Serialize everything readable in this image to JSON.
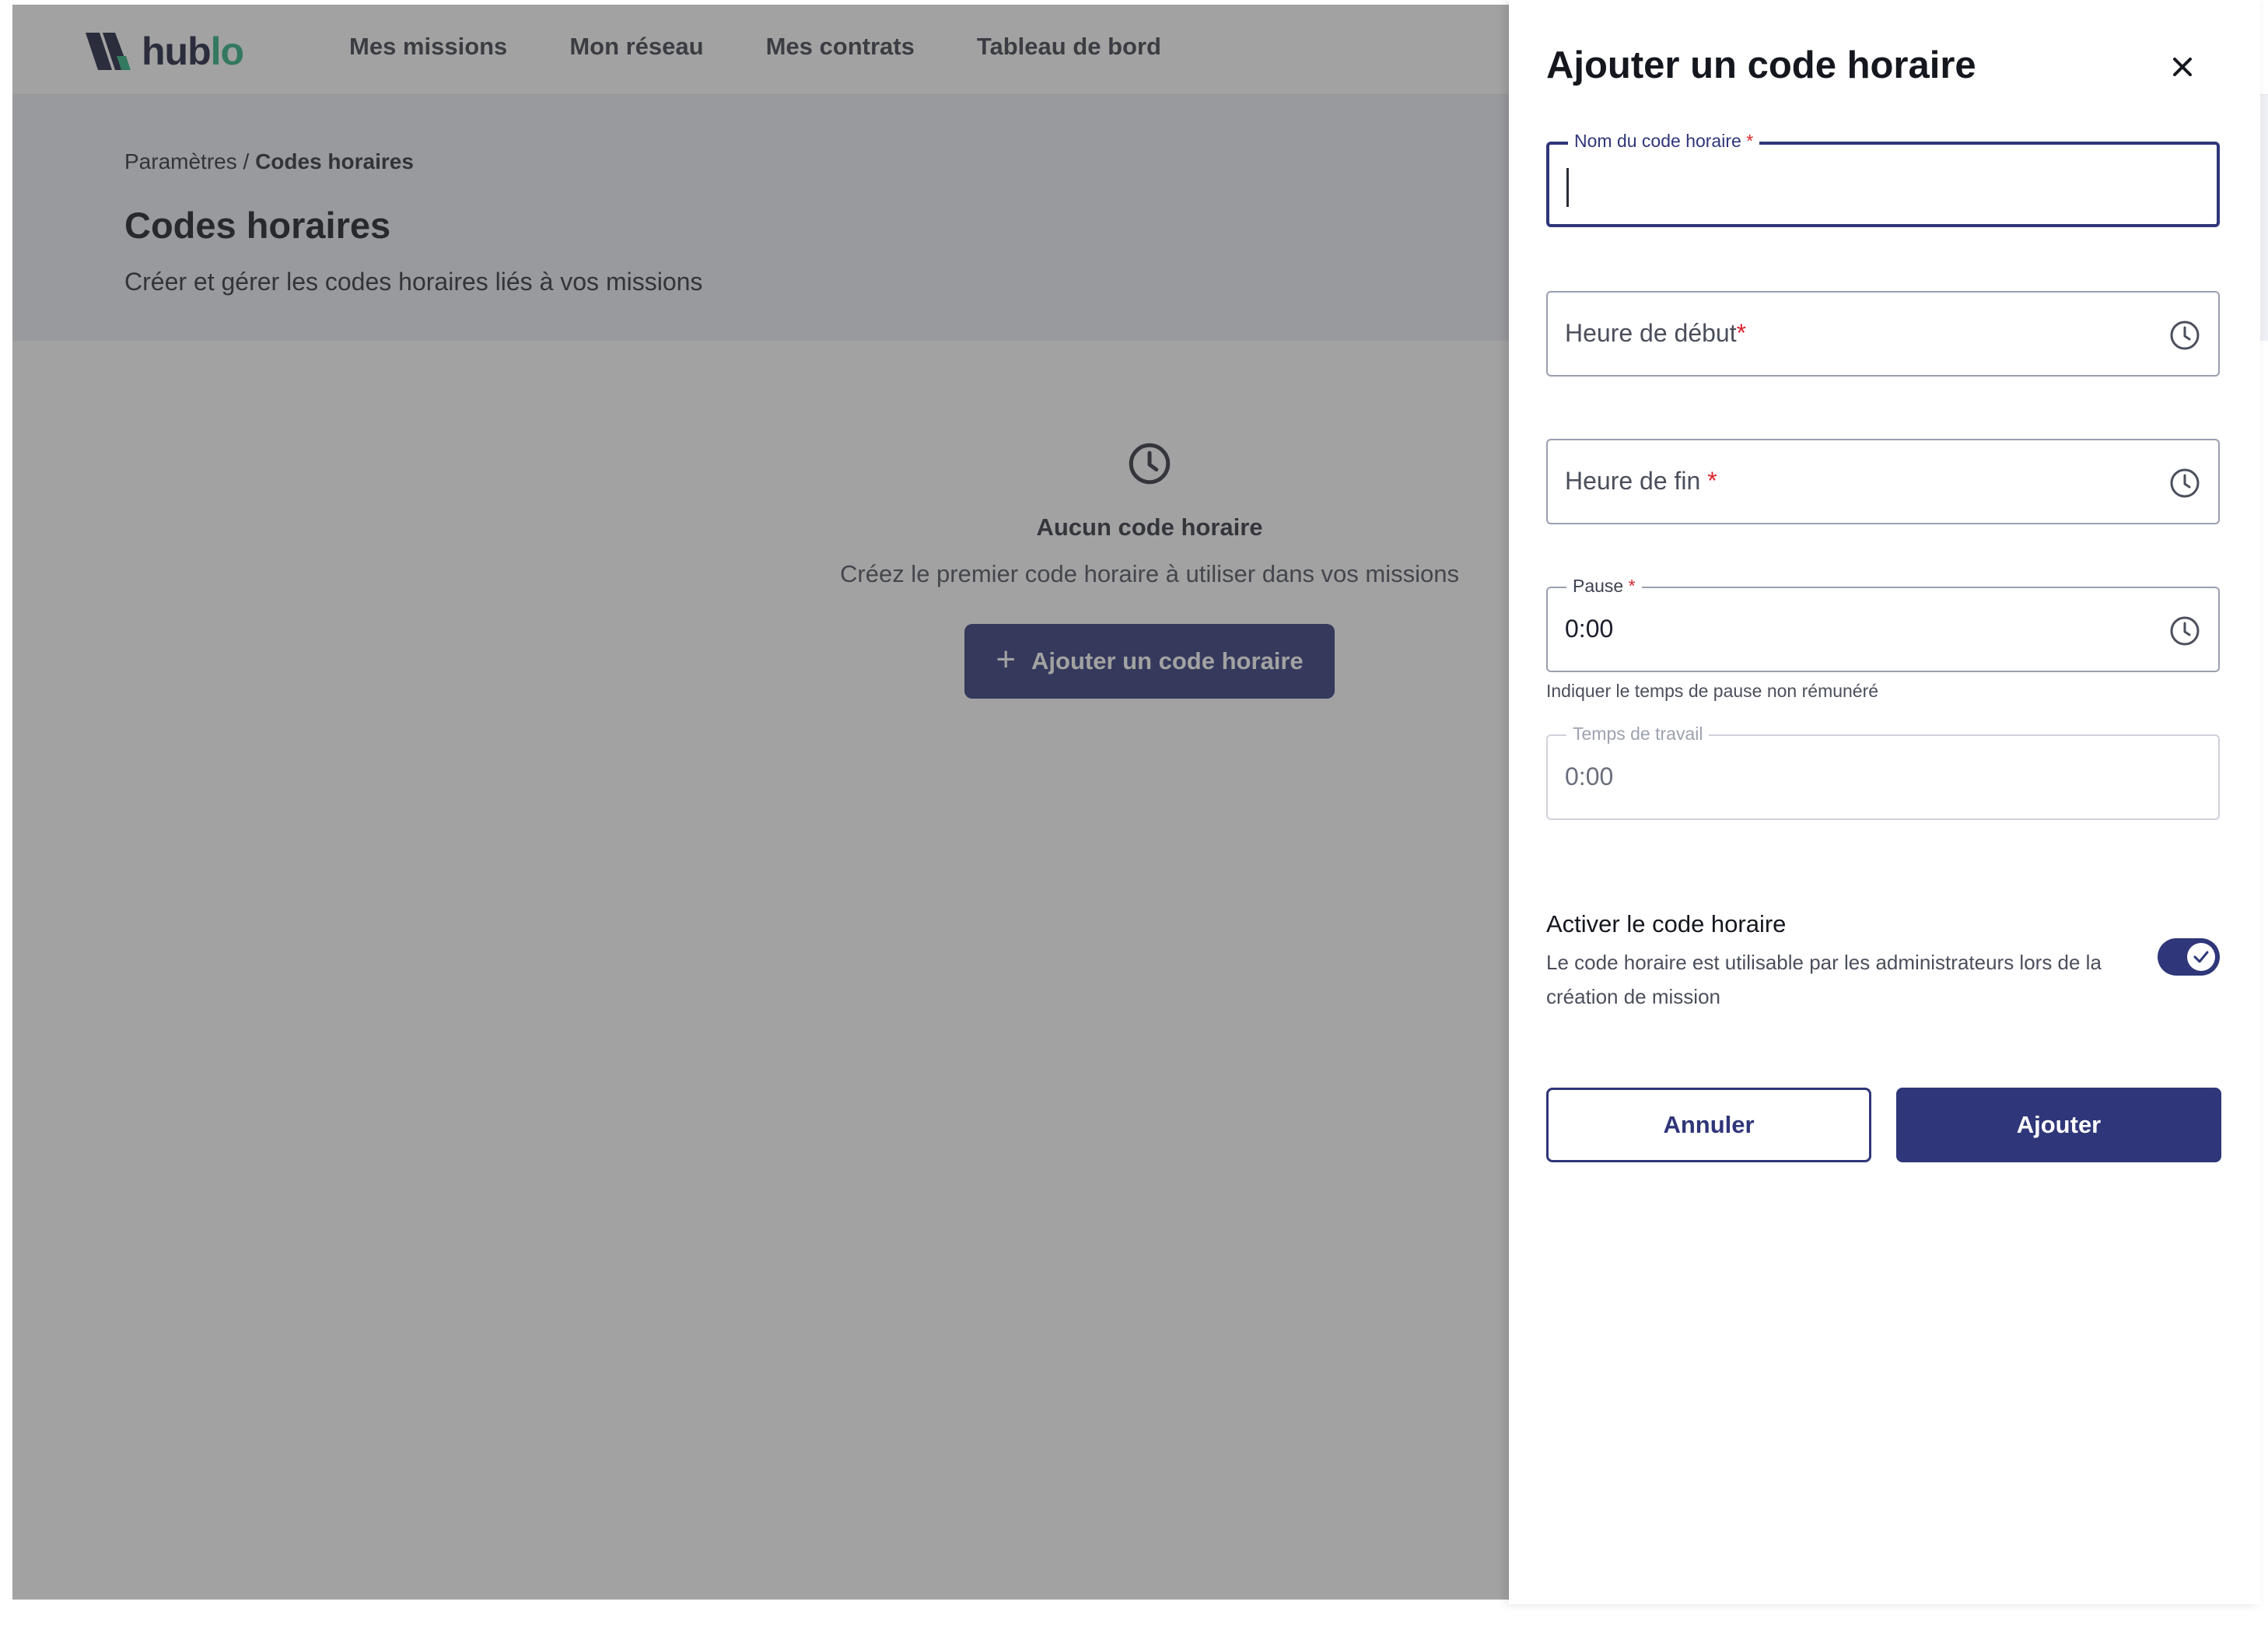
{
  "brand": {
    "name_part1": "hub",
    "name_part2": "lo"
  },
  "nav": {
    "items": [
      "Mes missions",
      "Mon réseau",
      "Mes contrats",
      "Tableau de bord"
    ]
  },
  "breadcrumb": {
    "parent": "Paramètres",
    "separator": "/",
    "current": "Codes horaires"
  },
  "page": {
    "title": "Codes horaires",
    "subtitle": "Créer et gérer les codes horaires liés à vos missions"
  },
  "empty_state": {
    "icon": "clock-icon",
    "title": "Aucun code horaire",
    "text": "Créez le premier code horaire à utiliser dans vos missions",
    "button_label": "Ajouter un code horaire"
  },
  "drawer": {
    "title": "Ajouter un code horaire",
    "fields": {
      "name": {
        "label": "Nom du code horaire",
        "required_mark": "*",
        "value": ""
      },
      "start": {
        "placeholder": "Heure de début",
        "required_mark": "*",
        "icon": "clock-icon"
      },
      "end": {
        "placeholder": "Heure de fin",
        "required_mark": "*",
        "icon": "clock-icon"
      },
      "pause": {
        "label": "Pause",
        "required_mark": "*",
        "value": "0:00",
        "icon": "clock-icon",
        "helper": "Indiquer le temps de pause non rémunéré"
      },
      "work_time": {
        "label": "Temps de travail",
        "value": "0:00"
      }
    },
    "activation": {
      "title": "Activer le code horaire",
      "description": "Le code horaire est utilisable par les administrateurs lors de la création de mission",
      "enabled": true
    },
    "cancel_label": "Annuler",
    "submit_label": "Ajouter"
  },
  "colors": {
    "primary": "#2f3679",
    "brand_green": "#2bb07f",
    "brand_dark": "#1c1e3c",
    "required": "#d8262c",
    "hero_bg": "#eef0f6"
  }
}
